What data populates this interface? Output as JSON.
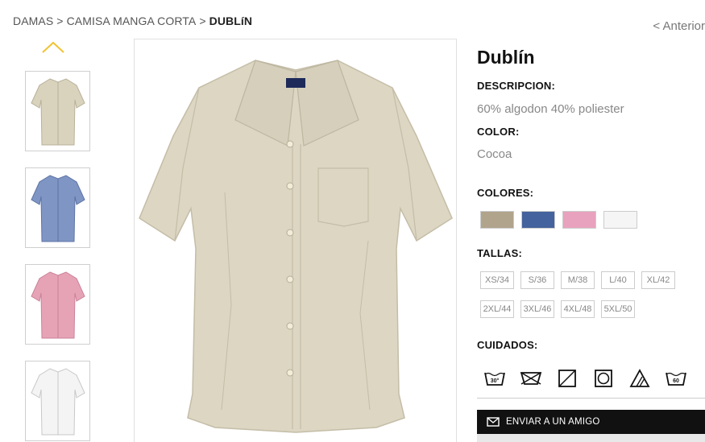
{
  "breadcrumb": {
    "items": [
      "DAMAS",
      "CAMISA MANGA CORTA"
    ],
    "separator": ">",
    "current": "DUBLíN"
  },
  "nav": {
    "previous_label": "< Anterior"
  },
  "gallery": {
    "thumbnails": [
      {
        "name": "shirt-cocoa-thumb",
        "color": "#d9d3bd"
      },
      {
        "name": "shirt-blue-thumb",
        "color": "#7f95c4"
      },
      {
        "name": "shirt-pink-thumb",
        "color": "#e7a3b6"
      },
      {
        "name": "shirt-white-thumb",
        "color": "#f4f4f4"
      }
    ],
    "main_color": "#dcd6c3"
  },
  "product": {
    "title": "Dublín",
    "description_label": "DESCRIPCION:",
    "description": "60% algodon 40% poliester",
    "color_label": "COLOR:",
    "color": "Cocoa",
    "colors_label": "COLORES:",
    "colors": [
      "#b0a48c",
      "#44629d",
      "#e8a2bd",
      "#f5f5f5"
    ],
    "sizes_label": "TALLAS:",
    "sizes": [
      "XS/34",
      "S/36",
      "M/38",
      "L/40",
      "XL/42",
      "2XL/44",
      "3XL/46",
      "4XL/48",
      "5XL/50"
    ],
    "care_label": "CUIDADOS:",
    "care_icons": [
      "wash-30-icon",
      "iron-icon",
      "tumble-dry-icon",
      "dryer-circle-icon",
      "bleach-icon",
      "wash-60-icon"
    ],
    "care_texts": {
      "wash30": "30°",
      "wash60": "60"
    }
  },
  "actions": {
    "send_friend_label": "ENVIAR A UN AMIGO"
  }
}
